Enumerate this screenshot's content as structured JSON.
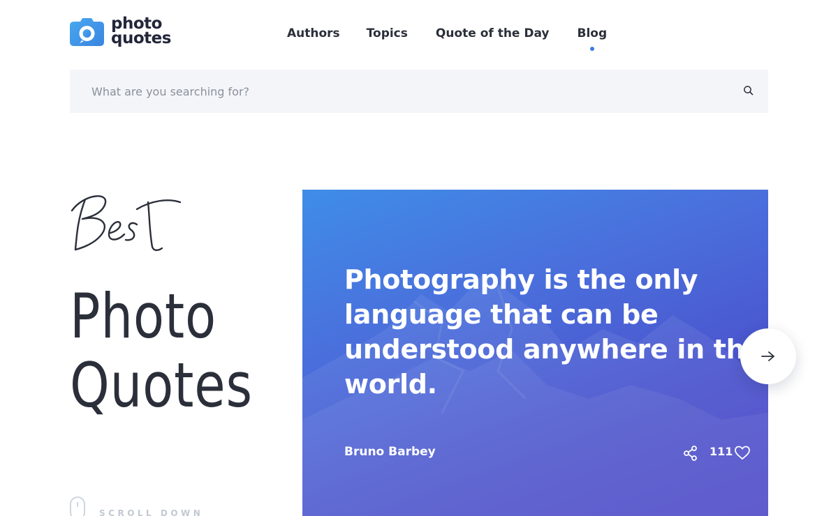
{
  "brand": {
    "name_line1": "photo",
    "name_line2": "quotes",
    "accent": "#3d8fe6"
  },
  "nav": {
    "items": [
      {
        "label": "Authors"
      },
      {
        "label": "Topics"
      },
      {
        "label": "Quote of the Day"
      },
      {
        "label": "Blog",
        "active": true
      }
    ],
    "active_color": "#3c7be6"
  },
  "search": {
    "placeholder": "What are you searching for?",
    "value": "",
    "icon": "search-icon"
  },
  "hero": {
    "script_word": "Best",
    "title_line1": "Photo",
    "title_line2": "Quotes",
    "scroll_label": "SCROLL DOWN"
  },
  "featured_quote": {
    "text": "Photography is the only language that can be understood anywhere in the world.",
    "author": "Bruno Barbey",
    "likes": "111",
    "share_icon": "share-icon",
    "like_icon": "heart-icon",
    "gradient": [
      "#3f8de8",
      "#4b44c6"
    ]
  },
  "carousel": {
    "next_icon": "arrow-right-icon"
  }
}
